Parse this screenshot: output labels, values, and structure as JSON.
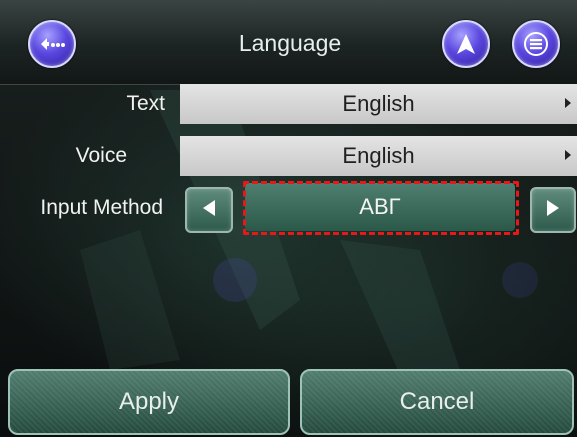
{
  "header": {
    "title": "Language",
    "back_icon": "back-ellipsis-icon",
    "navigate_icon": "navigation-arrow-icon",
    "menu_icon": "list-menu-icon"
  },
  "settings": {
    "text": {
      "label": "Text",
      "value": "English"
    },
    "voice": {
      "label": "Voice",
      "value": "English"
    },
    "input_method": {
      "label": "Input Method",
      "value": "ΑΒΓ"
    }
  },
  "footer": {
    "apply_label": "Apply",
    "cancel_label": "Cancel"
  },
  "colors": {
    "accent_green": "#2e5a4c",
    "highlight_red": "#e81818",
    "round_button_purple": "#5a48e0"
  }
}
